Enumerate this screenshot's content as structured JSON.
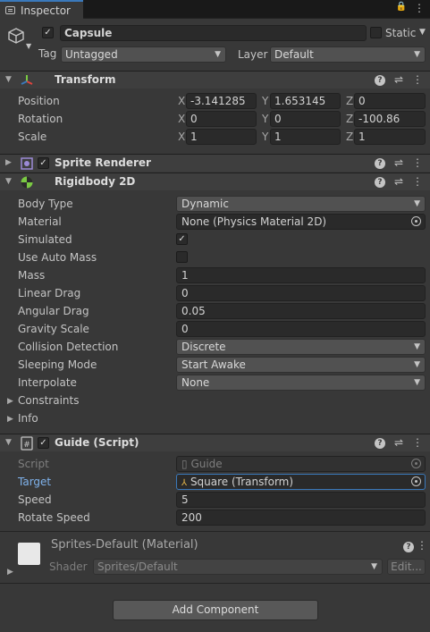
{
  "tab": {
    "label": "Inspector",
    "lock_glyph": "🔒",
    "menu_glyph": "⋮"
  },
  "header": {
    "active_checked": "✓",
    "name": "Capsule",
    "static_label": "Static",
    "tag_label": "Tag",
    "tag_value": "Untagged",
    "layer_label": "Layer",
    "layer_value": "Default"
  },
  "transform": {
    "title": "Transform",
    "position": {
      "label": "Position",
      "x": "-3.141285",
      "y": "1.653145",
      "z": "0"
    },
    "rotation": {
      "label": "Rotation",
      "x": "0",
      "y": "0",
      "z": "-100.86"
    },
    "scale": {
      "label": "Scale",
      "x": "1",
      "y": "1",
      "z": "1"
    },
    "axis_x": "X",
    "axis_y": "Y",
    "axis_z": "Z"
  },
  "sprite_renderer": {
    "title": "Sprite Renderer",
    "checked": "✓"
  },
  "rigidbody": {
    "title": "Rigidbody 2D",
    "body_type": {
      "label": "Body Type",
      "value": "Dynamic"
    },
    "material": {
      "label": "Material",
      "value": "None (Physics Material 2D)"
    },
    "simulated": {
      "label": "Simulated",
      "value": "✓"
    },
    "use_auto_mass": {
      "label": "Use Auto Mass",
      "value": ""
    },
    "mass": {
      "label": "Mass",
      "value": "1"
    },
    "linear_drag": {
      "label": "Linear Drag",
      "value": "0"
    },
    "angular_drag": {
      "label": "Angular Drag",
      "value": "0.05"
    },
    "gravity_scale": {
      "label": "Gravity Scale",
      "value": "0"
    },
    "collision_detection": {
      "label": "Collision Detection",
      "value": "Discrete"
    },
    "sleeping_mode": {
      "label": "Sleeping Mode",
      "value": "Start Awake"
    },
    "interpolate": {
      "label": "Interpolate",
      "value": "None"
    },
    "constraints": "Constraints",
    "info": "Info"
  },
  "guide": {
    "title": "Guide (Script)",
    "checked": "✓",
    "script": {
      "label": "Script",
      "value": "Guide"
    },
    "target": {
      "label": "Target",
      "value": "Square (Transform)"
    },
    "speed": {
      "label": "Speed",
      "value": "5"
    },
    "rotate_speed": {
      "label": "Rotate Speed",
      "value": "200"
    }
  },
  "material": {
    "title": "Sprites-Default (Material)",
    "shader_label": "Shader",
    "shader_value": "Sprites/Default",
    "edit_label": "Edit..."
  },
  "add_component_label": "Add Component",
  "colors": {
    "accent": "#3a79bb",
    "background": "#383838",
    "header": "#3e3e3e",
    "field": "#2a2a2a"
  }
}
